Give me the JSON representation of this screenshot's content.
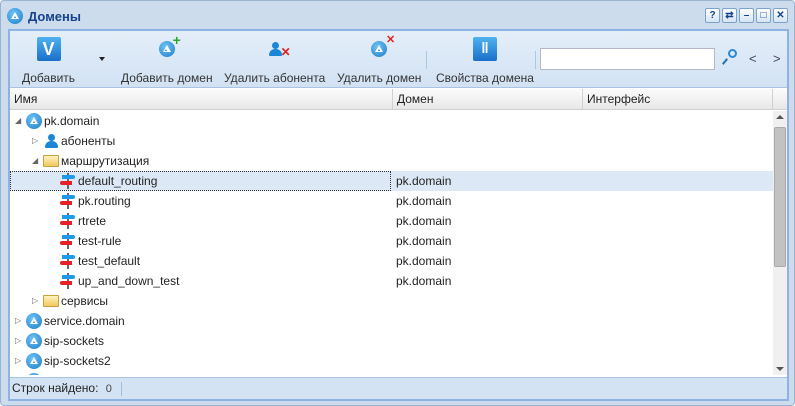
{
  "window": {
    "title": "Домены",
    "controls": [
      "?",
      "⇄",
      "–",
      "□",
      "✕"
    ]
  },
  "toolbar": {
    "add": "Добавить",
    "add_domain": "Добавить домен",
    "delete_subscriber": "Удалить абонента",
    "delete_domain": "Удалить домен",
    "domain_properties": "Свойства домена",
    "search_value": "",
    "prev": "<",
    "next": ">"
  },
  "columns": [
    "Имя",
    "Домен",
    "Интерфейс"
  ],
  "rows": [
    {
      "level": 0,
      "icon": "domain-icon",
      "toggle": "expanded",
      "name": "pk.domain",
      "domain": ""
    },
    {
      "level": 1,
      "icon": "subscribers-icon",
      "toggle": "collapsed",
      "name": "абоненты",
      "domain": ""
    },
    {
      "level": 1,
      "icon": "folder-icon",
      "toggle": "expanded",
      "name": "маршрутизация",
      "domain": ""
    },
    {
      "level": 2,
      "icon": "routing-icon",
      "toggle": "none",
      "name": "default_routing",
      "domain": "pk.domain",
      "selected": true
    },
    {
      "level": 2,
      "icon": "routing-icon",
      "toggle": "none",
      "name": "pk.routing",
      "domain": "pk.domain"
    },
    {
      "level": 2,
      "icon": "routing-icon",
      "toggle": "none",
      "name": "rtrete",
      "domain": "pk.domain"
    },
    {
      "level": 2,
      "icon": "routing-icon",
      "toggle": "none",
      "name": "test-rule",
      "domain": "pk.domain"
    },
    {
      "level": 2,
      "icon": "routing-icon",
      "toggle": "none",
      "name": "test_default",
      "domain": "pk.domain"
    },
    {
      "level": 2,
      "icon": "routing-icon",
      "toggle": "none",
      "name": "up_and_down_test",
      "domain": "pk.domain"
    },
    {
      "level": 1,
      "icon": "folder-icon",
      "toggle": "collapsed",
      "name": "сервисы",
      "domain": ""
    },
    {
      "level": 0,
      "icon": "domain-icon",
      "toggle": "collapsed",
      "name": "service.domain",
      "domain": ""
    },
    {
      "level": 0,
      "icon": "domain-icon",
      "toggle": "collapsed",
      "name": "sip-sockets",
      "domain": ""
    },
    {
      "level": 0,
      "icon": "domain-icon",
      "toggle": "collapsed",
      "name": "sip-sockets2",
      "domain": ""
    },
    {
      "level": 0,
      "icon": "domain-icon",
      "toggle": "collapsed",
      "name": "",
      "domain": ""
    }
  ],
  "status": {
    "label": "Строк найдено:",
    "count": "0"
  }
}
